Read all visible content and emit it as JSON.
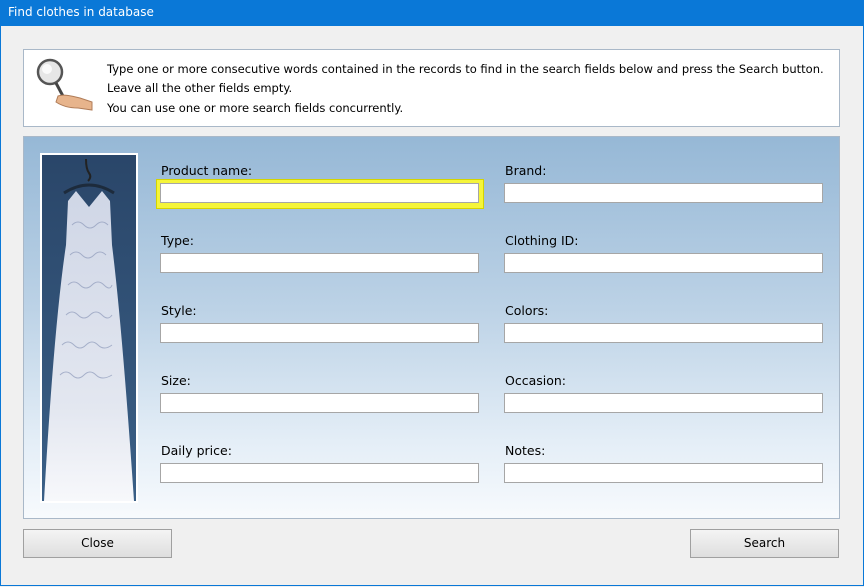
{
  "window": {
    "title": "Find clothes in database"
  },
  "info": {
    "icon": "magnifier-hand-icon",
    "lines": [
      "Type one or more consecutive words contained in the records to find in the search fields below and press the Search button.",
      "Leave all the other fields empty.",
      "You can use one or more search fields concurrently."
    ]
  },
  "fields": {
    "product_name": {
      "label": "Product name:",
      "value": ""
    },
    "brand": {
      "label": "Brand:",
      "value": ""
    },
    "type": {
      "label": "Type:",
      "value": ""
    },
    "clothing_id": {
      "label": "Clothing ID:",
      "value": ""
    },
    "style": {
      "label": "Style:",
      "value": ""
    },
    "colors": {
      "label": "Colors:",
      "value": ""
    },
    "size": {
      "label": "Size:",
      "value": ""
    },
    "occasion": {
      "label": "Occasion:",
      "value": ""
    },
    "daily_price": {
      "label": "Daily price:",
      "value": ""
    },
    "notes": {
      "label": "Notes:",
      "value": ""
    }
  },
  "focused_field": "product_name",
  "buttons": {
    "close": "Close",
    "search": "Search"
  },
  "colors": {
    "titlebar": "#0a78d7",
    "focus": "#f5f53a"
  }
}
